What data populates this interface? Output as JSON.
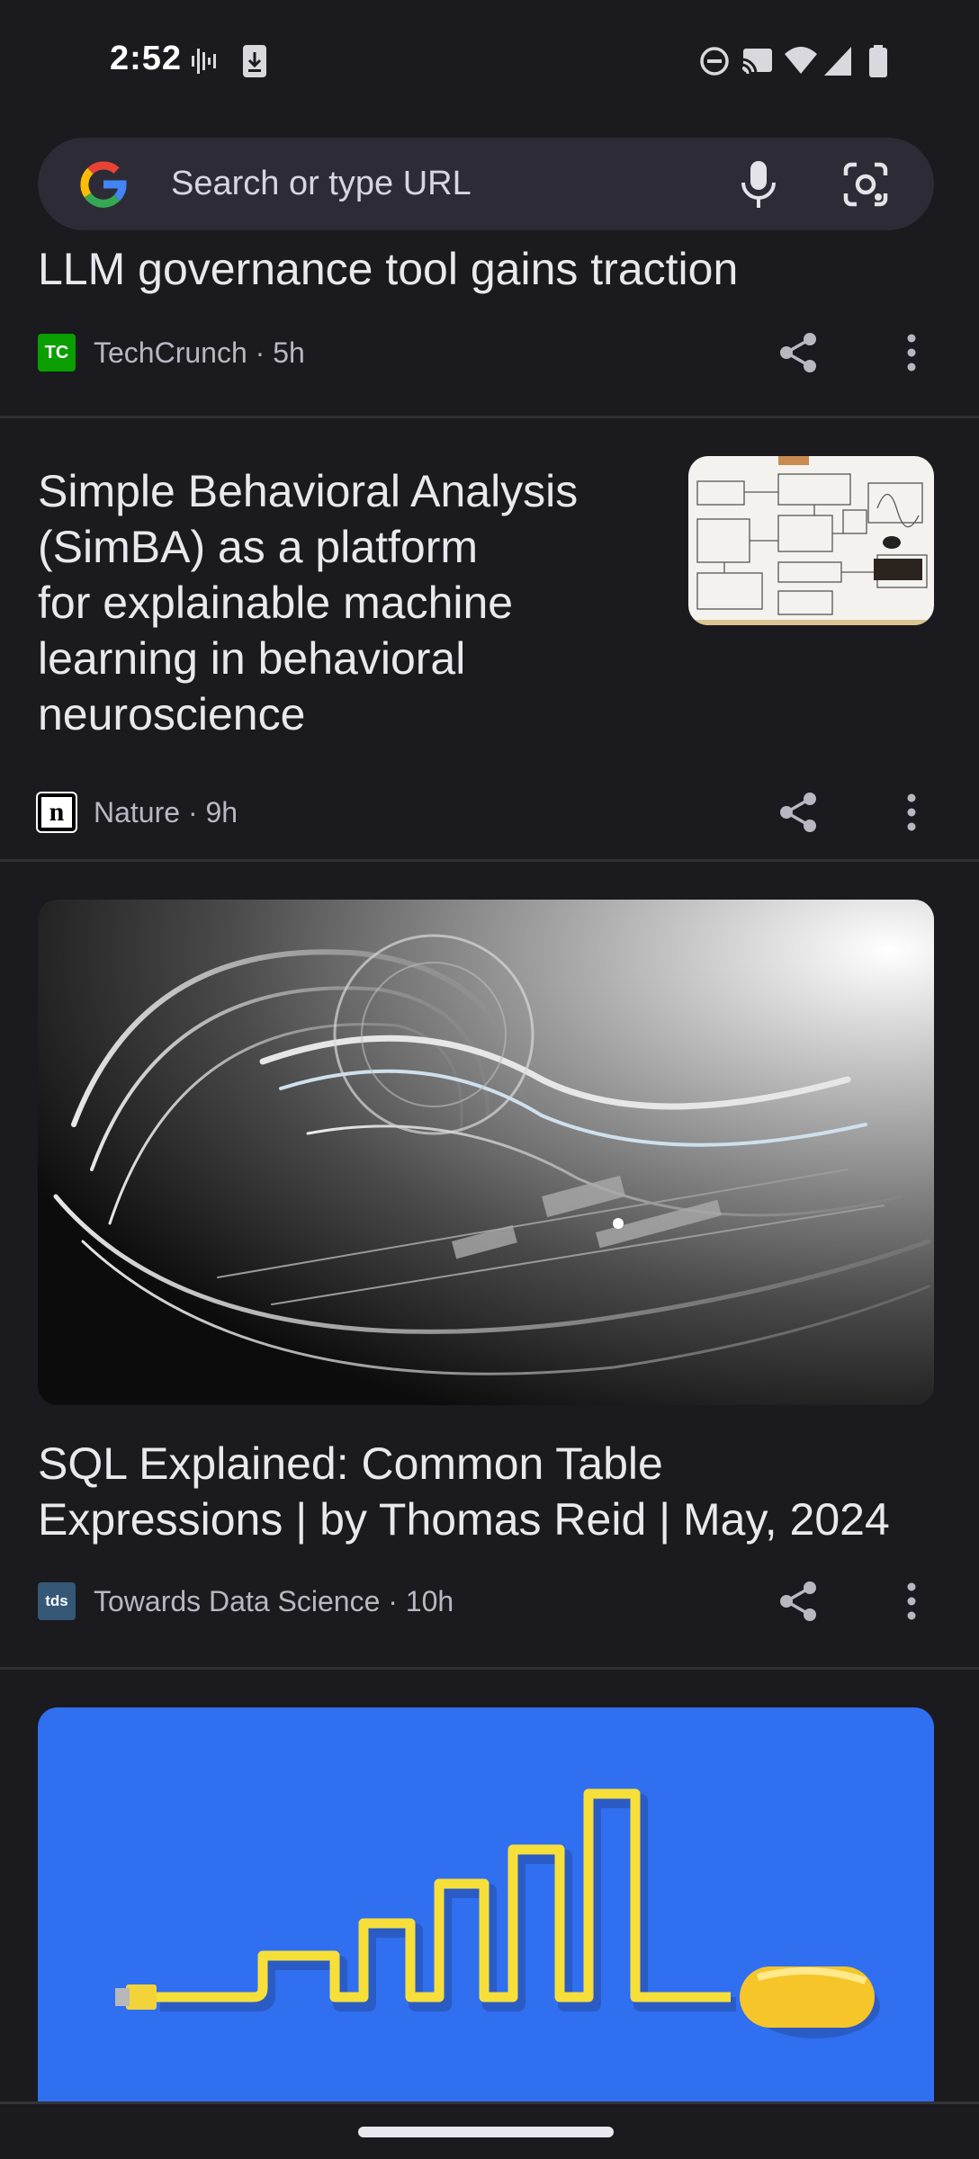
{
  "status_bar": {
    "time": "2:52",
    "icons": [
      "sound-wave-icon",
      "download-icon",
      "dnd-icon",
      "cast-icon",
      "wifi-icon",
      "signal-icon",
      "battery-icon"
    ]
  },
  "search": {
    "placeholder": "Search or type URL",
    "icons": [
      "google-logo",
      "mic-icon",
      "lens-icon"
    ]
  },
  "feed": {
    "items": [
      {
        "headline": "LLM governance tool gains traction",
        "source": "TechCrunch",
        "source_logo_text": "TC",
        "age": "5h",
        "meta": "TechCrunch · 5h"
      },
      {
        "headline_lines": [
          "Simple Behavioral Analysis",
          "(SimBA) as a platform",
          "for explainable machine",
          "learning in behavioral",
          "neuroscience"
        ],
        "source": "Nature",
        "source_logo_text": "n",
        "age": "9h",
        "meta": "Nature · 9h",
        "thumbnail": "diagram-thumbnail"
      },
      {
        "headline_lines": [
          "SQL Explained: Common Table",
          "Expressions | by Thomas Reid | May, 2024"
        ],
        "source": "Towards Data Science",
        "source_logo_text": "tds",
        "age": "10h",
        "meta": "Towards Data Science · 10h",
        "image": "abstract-swirl-image"
      },
      {
        "image": "usb-cable-bars-image"
      }
    ]
  },
  "colors": {
    "background": "#1a1a1f",
    "search_bg": "#2d2c36",
    "text": "#e8e8ee",
    "meta_text": "#b9b8c2",
    "techcrunch_green": "#0a9e01",
    "image_blue": "#2f6ff0"
  }
}
